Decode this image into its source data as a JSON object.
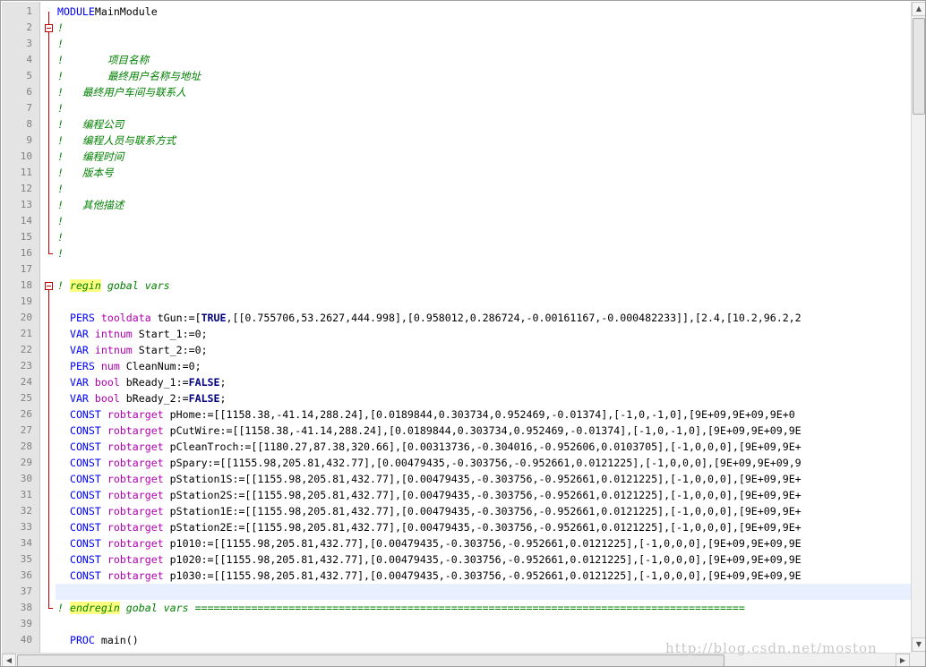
{
  "editor": {
    "lines": [
      {
        "n": "1",
        "parts": [
          [
            "kw",
            "MODULE"
          ],
          [
            "",
            "MainModule"
          ]
        ]
      },
      {
        "n": "2",
        "parts": [
          [
            "cm",
            "!"
          ]
        ]
      },
      {
        "n": "3",
        "parts": [
          [
            "cm",
            "!"
          ]
        ]
      },
      {
        "n": "4",
        "parts": [
          [
            "cm",
            "!       项目名称"
          ]
        ]
      },
      {
        "n": "5",
        "parts": [
          [
            "cm",
            "!       最终用户名称与地址"
          ]
        ]
      },
      {
        "n": "6",
        "parts": [
          [
            "cm",
            "!   最终用户车间与联系人"
          ]
        ]
      },
      {
        "n": "7",
        "parts": [
          [
            "cm",
            "!"
          ]
        ]
      },
      {
        "n": "8",
        "parts": [
          [
            "cm",
            "!   编程公司"
          ]
        ]
      },
      {
        "n": "9",
        "parts": [
          [
            "cm",
            "!   编程人员与联系方式"
          ]
        ]
      },
      {
        "n": "10",
        "parts": [
          [
            "cm",
            "!   编程时间"
          ]
        ]
      },
      {
        "n": "11",
        "parts": [
          [
            "cm",
            "!   版本号"
          ]
        ]
      },
      {
        "n": "12",
        "parts": [
          [
            "cm",
            "!"
          ]
        ]
      },
      {
        "n": "13",
        "parts": [
          [
            "cm",
            "!   其他描述"
          ]
        ]
      },
      {
        "n": "14",
        "parts": [
          [
            "cm",
            "!"
          ]
        ]
      },
      {
        "n": "15",
        "parts": [
          [
            "cm",
            "!"
          ]
        ]
      },
      {
        "n": "16",
        "parts": [
          [
            "cm",
            "!"
          ]
        ]
      },
      {
        "n": "17",
        "parts": []
      },
      {
        "n": "18",
        "parts": [
          [
            "cm",
            "! "
          ],
          [
            "cm hl",
            "regin"
          ],
          [
            "cm",
            " gobal vars"
          ]
        ]
      },
      {
        "n": "19",
        "parts": []
      },
      {
        "n": "20",
        "parts": [
          [
            "",
            "  "
          ],
          [
            "kw",
            "PERS"
          ],
          [
            "",
            " "
          ],
          [
            "ty",
            "tooldata"
          ],
          [
            "",
            " tGun:=["
          ],
          [
            "bold",
            "TRUE"
          ],
          [
            "",
            ",[[0.755706,53.2627,444.998],[0.958012,0.286724,-0.00161167,-0.000482233]],[2.4,[10.2,96.2,2"
          ]
        ]
      },
      {
        "n": "21",
        "parts": [
          [
            "",
            "  "
          ],
          [
            "kw",
            "VAR"
          ],
          [
            "",
            " "
          ],
          [
            "ty",
            "intnum"
          ],
          [
            "",
            " Start_1:=0;"
          ]
        ]
      },
      {
        "n": "22",
        "parts": [
          [
            "",
            "  "
          ],
          [
            "kw",
            "VAR"
          ],
          [
            "",
            " "
          ],
          [
            "ty",
            "intnum"
          ],
          [
            "",
            " Start_2:=0;"
          ]
        ]
      },
      {
        "n": "23",
        "parts": [
          [
            "",
            "  "
          ],
          [
            "kw",
            "PERS"
          ],
          [
            "",
            " "
          ],
          [
            "ty",
            "num"
          ],
          [
            "",
            " CleanNum:=0;"
          ]
        ]
      },
      {
        "n": "24",
        "parts": [
          [
            "",
            "  "
          ],
          [
            "kw",
            "VAR"
          ],
          [
            "",
            " "
          ],
          [
            "ty",
            "bool"
          ],
          [
            "",
            " bReady_1:="
          ],
          [
            "bold",
            "FALSE"
          ],
          [
            "",
            ";"
          ]
        ]
      },
      {
        "n": "25",
        "parts": [
          [
            "",
            "  "
          ],
          [
            "kw",
            "VAR"
          ],
          [
            "",
            " "
          ],
          [
            "ty",
            "bool"
          ],
          [
            "",
            " bReady_2:="
          ],
          [
            "bold",
            "FALSE"
          ],
          [
            "",
            ";"
          ]
        ]
      },
      {
        "n": "26",
        "parts": [
          [
            "",
            "  "
          ],
          [
            "kw",
            "CONST"
          ],
          [
            "",
            " "
          ],
          [
            "ty",
            "robtarget"
          ],
          [
            "",
            " pHome:=[[1158.38,-41.14,288.24],[0.0189844,0.303734,0.952469,-0.01374],[-1,0,-1,0],[9E+09,9E+09,9E+0"
          ]
        ]
      },
      {
        "n": "27",
        "parts": [
          [
            "",
            "  "
          ],
          [
            "kw",
            "CONST"
          ],
          [
            "",
            " "
          ],
          [
            "ty",
            "robtarget"
          ],
          [
            "",
            " pCutWire:=[[1158.38,-41.14,288.24],[0.0189844,0.303734,0.952469,-0.01374],[-1,0,-1,0],[9E+09,9E+09,9E"
          ]
        ]
      },
      {
        "n": "28",
        "parts": [
          [
            "",
            "  "
          ],
          [
            "kw",
            "CONST"
          ],
          [
            "",
            " "
          ],
          [
            "ty",
            "robtarget"
          ],
          [
            "",
            " pCleanTroch:=[[1180.27,87.38,320.66],[0.00313736,-0.304016,-0.952606,0.0103705],[-1,0,0,0],[9E+09,9E+"
          ]
        ]
      },
      {
        "n": "29",
        "parts": [
          [
            "",
            "  "
          ],
          [
            "kw",
            "CONST"
          ],
          [
            "",
            " "
          ],
          [
            "ty",
            "robtarget"
          ],
          [
            "",
            " pSpary:=[[1155.98,205.81,432.77],[0.00479435,-0.303756,-0.952661,0.0121225],[-1,0,0,0],[9E+09,9E+09,9"
          ]
        ]
      },
      {
        "n": "30",
        "parts": [
          [
            "",
            "  "
          ],
          [
            "kw",
            "CONST"
          ],
          [
            "",
            " "
          ],
          [
            "ty",
            "robtarget"
          ],
          [
            "",
            " pStation1S:=[[1155.98,205.81,432.77],[0.00479435,-0.303756,-0.952661,0.0121225],[-1,0,0,0],[9E+09,9E+"
          ]
        ]
      },
      {
        "n": "31",
        "parts": [
          [
            "",
            "  "
          ],
          [
            "kw",
            "CONST"
          ],
          [
            "",
            " "
          ],
          [
            "ty",
            "robtarget"
          ],
          [
            "",
            " pStation2S:=[[1155.98,205.81,432.77],[0.00479435,-0.303756,-0.952661,0.0121225],[-1,0,0,0],[9E+09,9E+"
          ]
        ]
      },
      {
        "n": "32",
        "parts": [
          [
            "",
            "  "
          ],
          [
            "kw",
            "CONST"
          ],
          [
            "",
            " "
          ],
          [
            "ty",
            "robtarget"
          ],
          [
            "",
            " pStation1E:=[[1155.98,205.81,432.77],[0.00479435,-0.303756,-0.952661,0.0121225],[-1,0,0,0],[9E+09,9E+"
          ]
        ]
      },
      {
        "n": "33",
        "parts": [
          [
            "",
            "  "
          ],
          [
            "kw",
            "CONST"
          ],
          [
            "",
            " "
          ],
          [
            "ty",
            "robtarget"
          ],
          [
            "",
            " pStation2E:=[[1155.98,205.81,432.77],[0.00479435,-0.303756,-0.952661,0.0121225],[-1,0,0,0],[9E+09,9E+"
          ]
        ]
      },
      {
        "n": "34",
        "parts": [
          [
            "",
            "  "
          ],
          [
            "kw",
            "CONST"
          ],
          [
            "",
            " "
          ],
          [
            "ty",
            "robtarget"
          ],
          [
            "",
            " p1010:=[[1155.98,205.81,432.77],[0.00479435,-0.303756,-0.952661,0.0121225],[-1,0,0,0],[9E+09,9E+09,9E"
          ]
        ]
      },
      {
        "n": "35",
        "parts": [
          [
            "",
            "  "
          ],
          [
            "kw",
            "CONST"
          ],
          [
            "",
            " "
          ],
          [
            "ty",
            "robtarget"
          ],
          [
            "",
            " p1020:=[[1155.98,205.81,432.77],[0.00479435,-0.303756,-0.952661,0.0121225],[-1,0,0,0],[9E+09,9E+09,9E"
          ]
        ]
      },
      {
        "n": "36",
        "parts": [
          [
            "",
            "  "
          ],
          [
            "kw",
            "CONST"
          ],
          [
            "",
            " "
          ],
          [
            "ty",
            "robtarget"
          ],
          [
            "",
            " p1030:=[[1155.98,205.81,432.77],[0.00479435,-0.303756,-0.952661,0.0121225],[-1,0,0,0],[9E+09,9E+09,9E"
          ]
        ]
      },
      {
        "n": "37",
        "parts": []
      },
      {
        "n": "38",
        "parts": [
          [
            "cm",
            "! "
          ],
          [
            "cm hl",
            "endregin"
          ],
          [
            "cm",
            " gobal vars ========================================================================================"
          ]
        ]
      },
      {
        "n": "39",
        "parts": []
      },
      {
        "n": "40",
        "parts": [
          [
            "",
            "  "
          ],
          [
            "kw",
            "PROC"
          ],
          [
            "",
            " main()"
          ]
        ]
      }
    ],
    "current_line": "37"
  },
  "scroll": {
    "up_arrow": "▲",
    "down_arrow": "▼",
    "left_arrow": "◀",
    "right_arrow": "▶"
  },
  "watermark": "http://blog.csdn.net/moston"
}
